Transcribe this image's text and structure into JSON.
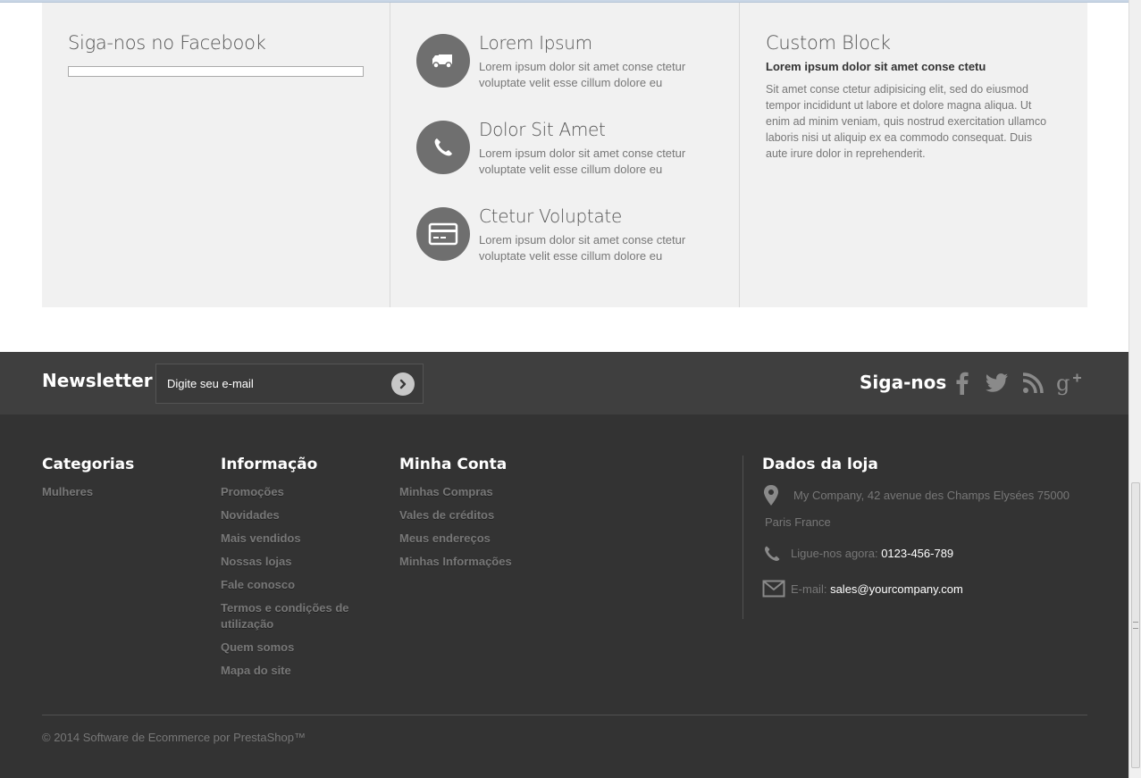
{
  "facebook": {
    "title": "Siga-nos no Facebook"
  },
  "info_items": [
    {
      "title": "Lorem Ipsum",
      "desc": "Lorem ipsum dolor sit amet conse ctetur voluptate velit esse cillum dolore eu",
      "icon": "truck-icon"
    },
    {
      "title": "Dolor Sit Amet",
      "desc": "Lorem ipsum dolor sit amet conse ctetur voluptate velit esse cillum dolore eu",
      "icon": "phone-icon"
    },
    {
      "title": "Ctetur Voluptate",
      "desc": "Lorem ipsum dolor sit amet conse ctetur voluptate velit esse cillum dolore eu",
      "icon": "credit-card-icon"
    }
  ],
  "custom_block": {
    "title": "Custom Block",
    "subtitle": "Lorem ipsum dolor sit amet conse ctetu",
    "body": "Sit amet conse ctetur adipisicing elit, sed do eiusmod tempor incididunt ut labore et dolore magna aliqua. Ut enim ad minim veniam, quis nostrud exercitation ullamco laboris nisi ut aliquip ex ea commodo consequat. Duis aute irure dolor in reprehenderit."
  },
  "newsletter": {
    "title": "Newsletter",
    "placeholder": "Digite seu e-mail"
  },
  "social": {
    "title": "Siga-nos",
    "icons": [
      "facebook-icon",
      "twitter-icon",
      "rss-icon",
      "google-plus-icon"
    ]
  },
  "categories": {
    "title": "Categorias",
    "links": [
      "Mulheres"
    ]
  },
  "information": {
    "title": "Informação",
    "links": [
      "Promoções",
      "Novidades",
      "Mais vendidos",
      "Nossas lojas",
      "Fale conosco",
      "Termos e condições de utilização",
      "Quem somos",
      "Mapa do site"
    ]
  },
  "account": {
    "title": "Minha Conta",
    "links": [
      "Minhas Compras",
      "Vales de créditos",
      "Meus endereços",
      "Minhas Informações"
    ]
  },
  "store": {
    "title": "Dados da loja",
    "address": "My Company, 42 avenue des Champs Elysées 75000 Paris France",
    "phone_label": "Ligue-nos agora:",
    "phone": "0123-456-789",
    "email_label": "E-mail:",
    "email": "sales@yourcompany.com"
  },
  "copyright": "© 2014 Software de Ecommerce por PrestaShop™"
}
